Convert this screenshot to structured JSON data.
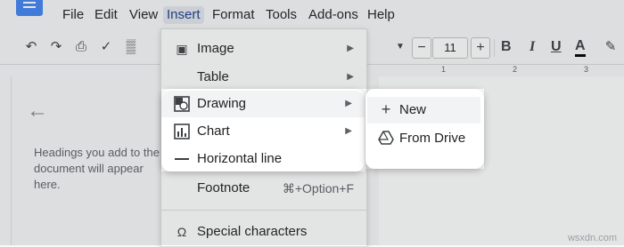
{
  "menubar": {
    "items": [
      "File",
      "Edit",
      "View",
      "Insert",
      "Format",
      "Tools",
      "Add-ons",
      "Help"
    ],
    "active": "Insert"
  },
  "toolbar": {
    "font_size": "11",
    "minus": "−",
    "plus": "+",
    "bold": "B",
    "italic": "I",
    "underline": "U",
    "text_color": "A"
  },
  "ruler": {
    "numbers": [
      "1",
      "2",
      "3"
    ]
  },
  "outline": {
    "placeholder": "Headings you add to the document will appear here."
  },
  "insert_menu": {
    "image": "Image",
    "table": "Table",
    "footnote": "Footnote",
    "footnote_shortcut": "⌘+Option+F",
    "special_characters": "Special characters"
  },
  "highlight": {
    "drawing": "Drawing",
    "chart": "Chart",
    "horizontal_line": "Horizontal line"
  },
  "submenu": {
    "new": "New",
    "from_drive": "From Drive"
  },
  "watermark": "wsxdn.com",
  "colors": {
    "accent": "#4285f4",
    "highlight_bg": "#f1f3f4",
    "menu_active": "#e3e7ee"
  }
}
